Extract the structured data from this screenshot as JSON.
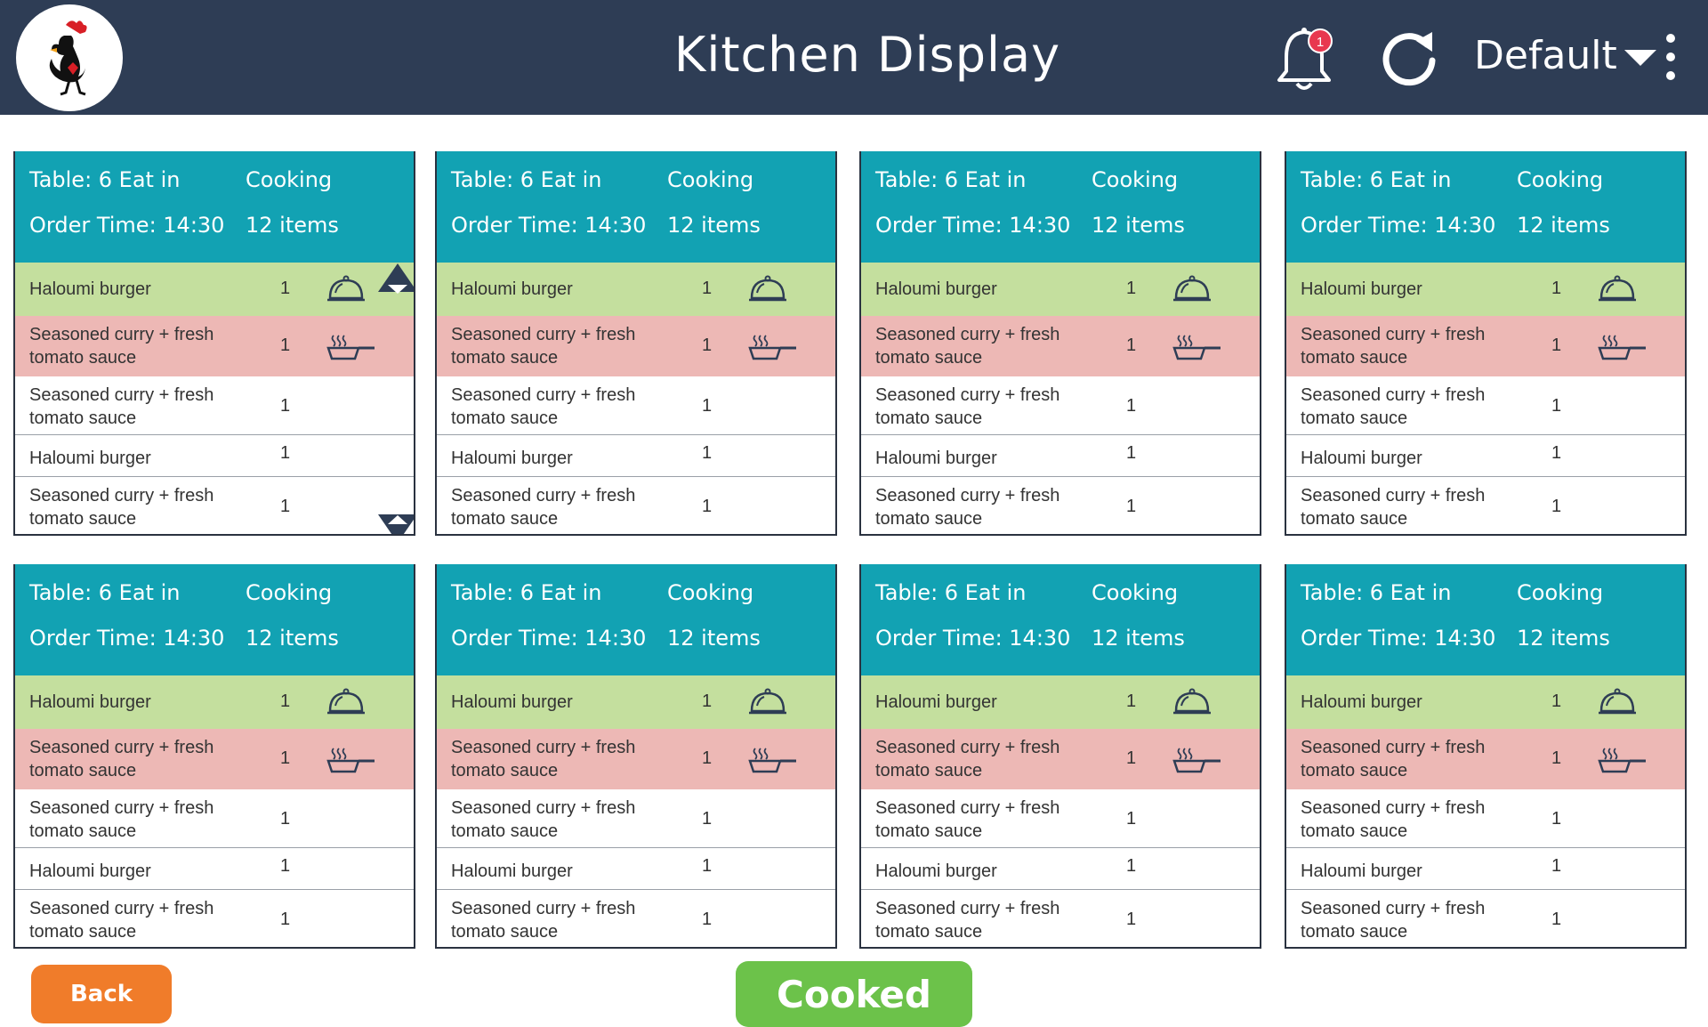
{
  "header": {
    "title": "Kitchen Display",
    "notification_count": "1",
    "profile_label": "Default"
  },
  "orders": [
    {
      "table_label": "Table:  6   Eat in",
      "status": "Cooking",
      "order_time_label": "Order Time:  14:30",
      "item_count": "12 items"
    },
    {
      "table_label": "Table:  6   Eat in",
      "status": "Cooking",
      "order_time_label": "Order Time:  14:30",
      "item_count": "12 items"
    },
    {
      "table_label": "Table:  6   Eat in",
      "status": "Cooking",
      "order_time_label": "Order Time:  14:30",
      "item_count": "12 items"
    },
    {
      "table_label": "Table:  6   Eat in",
      "status": "Cooking",
      "order_time_label": "Order Time:  14:30",
      "item_count": "12 items"
    },
    {
      "table_label": "Table:  6   Eat in",
      "status": "Cooking",
      "order_time_label": "Order Time:  14:30",
      "item_count": "12 items"
    },
    {
      "table_label": "Table:  6   Eat in",
      "status": "Cooking",
      "order_time_label": "Order Time:  14:30",
      "item_count": "12 items"
    },
    {
      "table_label": "Table:  6   Eat in",
      "status": "Cooking",
      "order_time_label": "Order Time:  14:30",
      "item_count": "12 items"
    },
    {
      "table_label": "Table:  6   Eat in",
      "status": "Cooking",
      "order_time_label": "Order Time:  14:30",
      "item_count": "12 items"
    }
  ],
  "items": [
    {
      "line1": "Haloumi burger",
      "line2": "",
      "qty": "1",
      "state": "ready",
      "icon": "serving-cloche-icon",
      "color": "#c4df9e"
    },
    {
      "line1": "Seasoned curry + fresh",
      "line2": "tomato sauce",
      "qty": "1",
      "state": "cooking",
      "icon": "frying-pan-icon",
      "color": "#edb8b5"
    },
    {
      "line1": "Seasoned curry + fresh",
      "line2": "tomato sauce",
      "qty": "1",
      "state": "pending",
      "icon": "",
      "color": "#ffffff"
    },
    {
      "line1": "Haloumi burger",
      "line2": "",
      "qty": "1",
      "state": "pending",
      "icon": "",
      "color": "#ffffff"
    },
    {
      "line1": "Seasoned curry + fresh",
      "line2": "tomato sauce",
      "qty": "1",
      "state": "pending",
      "icon": "",
      "color": "#ffffff"
    }
  ],
  "footer": {
    "back_label": "Back",
    "cooked_label": "Cooked"
  },
  "colors": {
    "header_bg": "#2e3d55",
    "card_header": "#12a2b3",
    "ready_row": "#c4df9e",
    "cooking_row": "#edb8b5",
    "back_button": "#f07c2a",
    "cooked_button": "#6cc24a",
    "badge": "#e8384f"
  }
}
